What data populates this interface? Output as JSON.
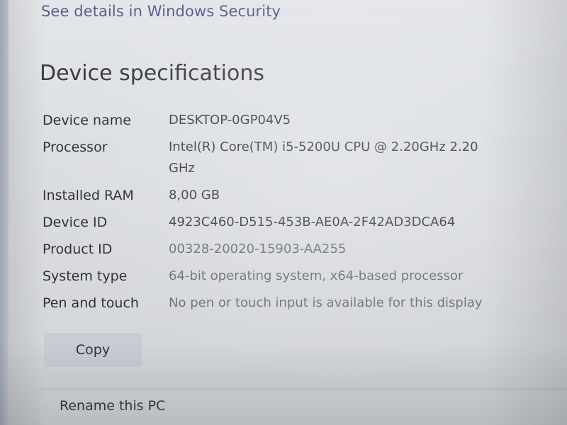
{
  "security_link": "See details in Windows Security",
  "section_title": "Device specifications",
  "specs": [
    {
      "label": "Device name",
      "value": "DESKTOP-0GP04V5"
    },
    {
      "label": "Processor",
      "value": "Intel(R) Core(TM) i5-5200U CPU @ 2.20GHz   2.20 GHz"
    },
    {
      "label": "Installed RAM",
      "value": "8,00 GB"
    },
    {
      "label": "Device ID",
      "value": "4923C460-D515-453B-AE0A-2F42AD3DCA64"
    },
    {
      "label": "Product ID",
      "value": "00328-20020-15903-AA255"
    },
    {
      "label": "System type",
      "value": "64-bit operating system, x64-based processor"
    },
    {
      "label": "Pen and touch",
      "value": "No pen or touch input is available for this display"
    }
  ],
  "copy_label": "Copy",
  "rename_label": "Rename this PC"
}
